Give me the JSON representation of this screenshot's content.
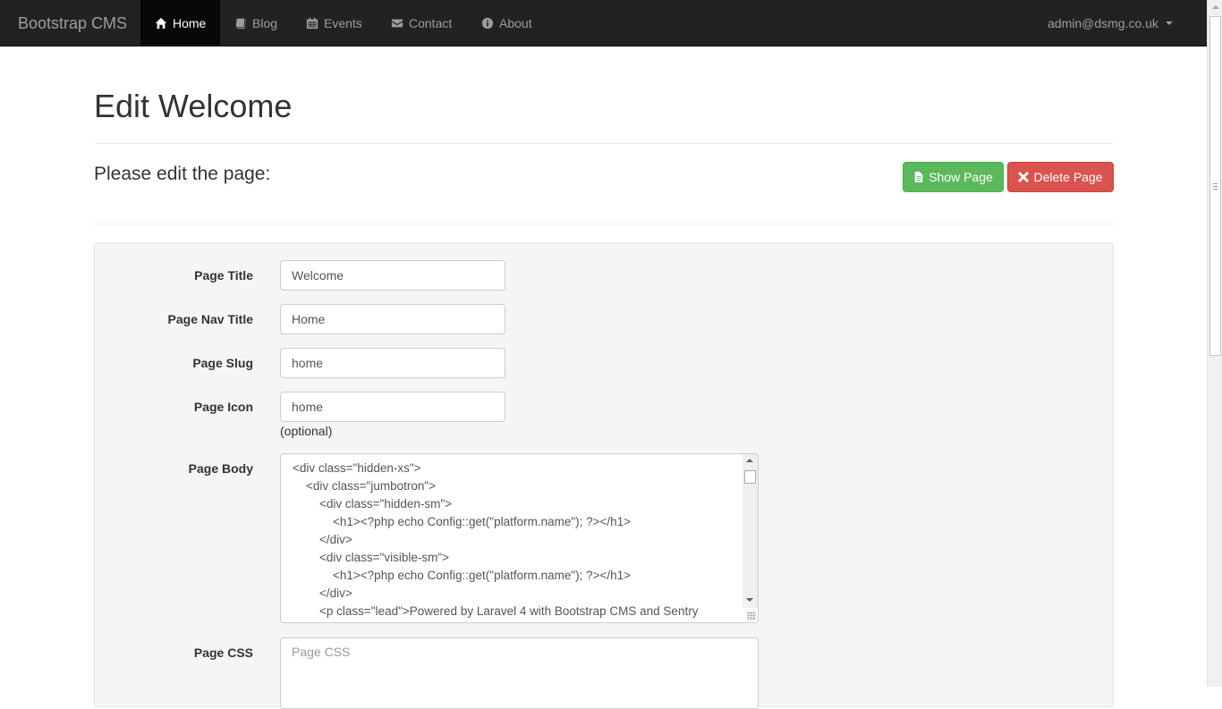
{
  "navbar": {
    "brand": "Bootstrap CMS",
    "items": [
      {
        "label": "Home",
        "icon": "home-icon",
        "active": true
      },
      {
        "label": "Blog",
        "icon": "book-icon",
        "active": false
      },
      {
        "label": "Events",
        "icon": "calendar-icon",
        "active": false
      },
      {
        "label": "Contact",
        "icon": "envelope-icon",
        "active": false
      },
      {
        "label": "About",
        "icon": "info-circle-icon",
        "active": false
      }
    ],
    "user": "admin@dsmg.co.uk"
  },
  "header": {
    "title": "Edit Welcome",
    "subtitle": "Please edit the page:",
    "show_button": "Show Page",
    "delete_button": "Delete Page"
  },
  "form": {
    "page_title": {
      "label": "Page Title",
      "value": "Welcome"
    },
    "page_nav_title": {
      "label": "Page Nav Title",
      "value": "Home"
    },
    "page_slug": {
      "label": "Page Slug",
      "value": "home"
    },
    "page_icon": {
      "label": "Page Icon",
      "value": "home",
      "help": "(optional)"
    },
    "page_body": {
      "label": "Page Body",
      "lines": [
        "<div class=\"hidden-xs\">",
        "    <div class=\"jumbotron\">",
        "        <div class=\"hidden-sm\">",
        "            <h1><?php echo Config::get(\"platform.name\"); ?></h1>",
        "        </div>",
        "        <div class=\"visible-sm\">",
        "            <h1><?php echo Config::get(\"platform.name\"); ?></h1>",
        "        </div>",
        "        <p class=\"lead\">Powered by Laravel 4 with Bootstrap CMS and Sentry"
      ]
    },
    "page_css": {
      "label": "Page CSS",
      "placeholder": "Page CSS"
    }
  },
  "colors": {
    "navbar": "#222222",
    "success": "#5cb85c",
    "danger": "#d9534f"
  }
}
